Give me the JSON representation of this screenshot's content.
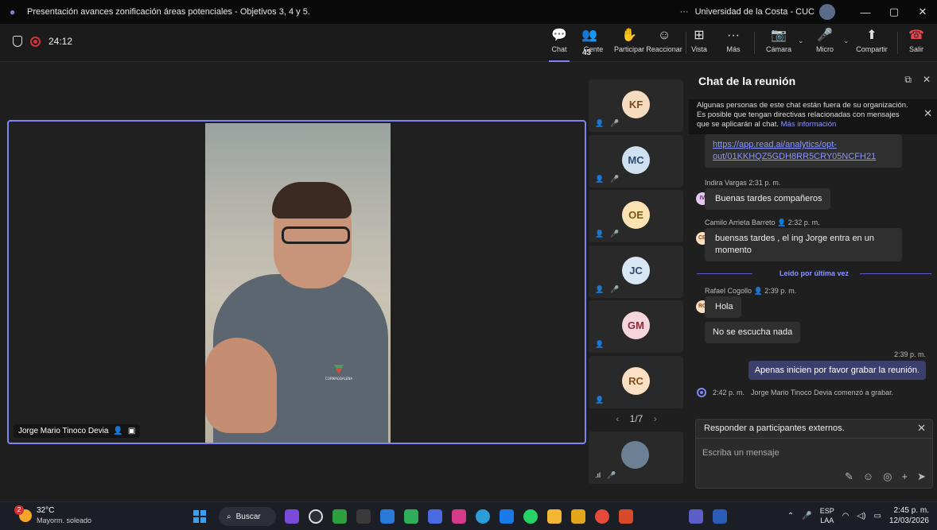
{
  "window": {
    "title": "Presentación avances zonificación áreas potenciales - Objetivos 3, 4 y 5.",
    "org": "Universidad de la Costa - CUC",
    "more": "···",
    "minimize": "—",
    "restore": "▢",
    "close": "✕"
  },
  "toolbar": {
    "timer": "24:12",
    "chat": "Chat",
    "people": "Gente",
    "people_count": "43",
    "raise": "Participar",
    "react": "Reaccionar",
    "view": "Vista",
    "more": "Más",
    "camera": "Cámara",
    "mic": "Micro",
    "share": "Compartir",
    "leave": "Salir"
  },
  "stage": {
    "speaker_name": "Jorge Mario Tinoco Devia",
    "shirt_logo": "CORMAGDALENA"
  },
  "participants": [
    {
      "initials": "KF",
      "bg": "#f5dcc0",
      "fg": "#7a4a1a"
    },
    {
      "initials": "MC",
      "bg": "#cfe0f0",
      "fg": "#2c4a6e"
    },
    {
      "initials": "OE",
      "bg": "#fbe3b4",
      "fg": "#7a5510"
    },
    {
      "initials": "JC",
      "bg": "#d9e6f5",
      "fg": "#2c4a6e"
    },
    {
      "initials": "GM",
      "bg": "#f7d5dc",
      "fg": "#8a2a3a"
    },
    {
      "initials": "RC",
      "bg": "#fbe0c4",
      "fg": "#8a4d12"
    }
  ],
  "pager": {
    "label": "1/7",
    "prev": "‹",
    "next": "›"
  },
  "chat": {
    "title": "Chat de la reunión",
    "banner_text": "Algunas personas de este chat están fuera de su organización. Es posible que tengan directivas relacionadas con mensajes que se aplicarán al chat.",
    "banner_link": "Más información",
    "link_msg": "https://app.read.ai/analytics/opt-out/01KKHQZ5GDH8RR5CRY05NCFH21",
    "m1_meta": "Indira Vargas  2:31 p. m.",
    "m1_av": "IV",
    "m1_text": "Buenas tardes compañeros",
    "m2_meta": "Camilo Arrieta Barreto",
    "m2_time": "2:32 p. m.",
    "m2_av": "CB",
    "m2_text": "buensas tardes , el ing Jorge entra en un momento",
    "last_read": "Leído por última vez",
    "m3_meta": "Rafael Cogollo",
    "m3_time": "2:39 p. m.",
    "m3_av": "RC",
    "m3_text1": "Hola",
    "m3_text2": "No se escucha nada",
    "mine_time": "2:39 p. m.",
    "mine_text": "Apenas inicien por favor grabar la reunión.",
    "rec_time": "2:42 p. m.",
    "rec_text": "Jorge Mario Tinoco Devia comenzó a grabar.",
    "reply_external": "Responder a participantes externos.",
    "input_placeholder": "Escriba un mensaje"
  },
  "taskbar": {
    "temp": "32°C",
    "weather": "Mayorm. soleado",
    "weather_badge": "2",
    "search": "Buscar",
    "lang1": "ESP",
    "lang2": "LAA",
    "time": "2:45 p. m.",
    "date": "12/03/2026"
  }
}
